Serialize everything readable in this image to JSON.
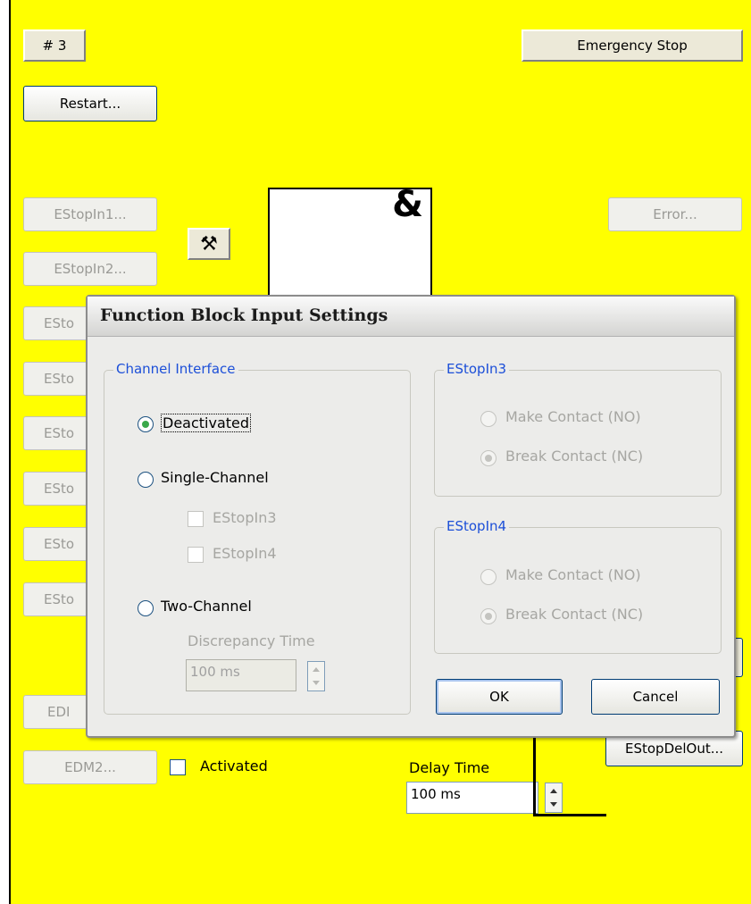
{
  "header": {
    "number_label": "# 3",
    "title_button": "Emergency Stop",
    "restart_button": "Restart..."
  },
  "inputs": [
    "EStopIn1...",
    "EStopIn2...",
    "ESto",
    "ESto",
    "ESto",
    "ESto",
    "ESto",
    "ESto"
  ],
  "error_button": "Error...",
  "and_symbol": "&",
  "tool_icon": "hammer-wrench-icon",
  "edm": {
    "edm1_label": "EDI",
    "edm2_label": "EDM2...",
    "activated_label": "Activated"
  },
  "delay": {
    "label": "Delay Time",
    "value": "100 ms"
  },
  "output_button": "EStopDelOut...",
  "dialog": {
    "title": "Function Block Input Settings",
    "channel_interface": {
      "legend": "Channel Interface",
      "deactivated": "Deactivated",
      "single_channel": "Single-Channel",
      "estopin3": "EStopIn3",
      "estopin4": "EStopIn4",
      "two_channel": "Two-Channel",
      "discrepancy_label": "Discrepancy Time",
      "discrepancy_value": "100 ms",
      "selected": "deactivated"
    },
    "estopin3_group": {
      "legend": "EStopIn3",
      "make": "Make Contact (NO)",
      "break": "Break Contact (NC)"
    },
    "estopin4_group": {
      "legend": "EStopIn4",
      "make": "Make Contact (NO)",
      "break": "Break Contact (NC)"
    },
    "ok": "OK",
    "cancel": "Cancel"
  },
  "colors": {
    "background": "#ffff00",
    "legend": "#1c4fd8",
    "radio_selected": "#3aa84a"
  }
}
